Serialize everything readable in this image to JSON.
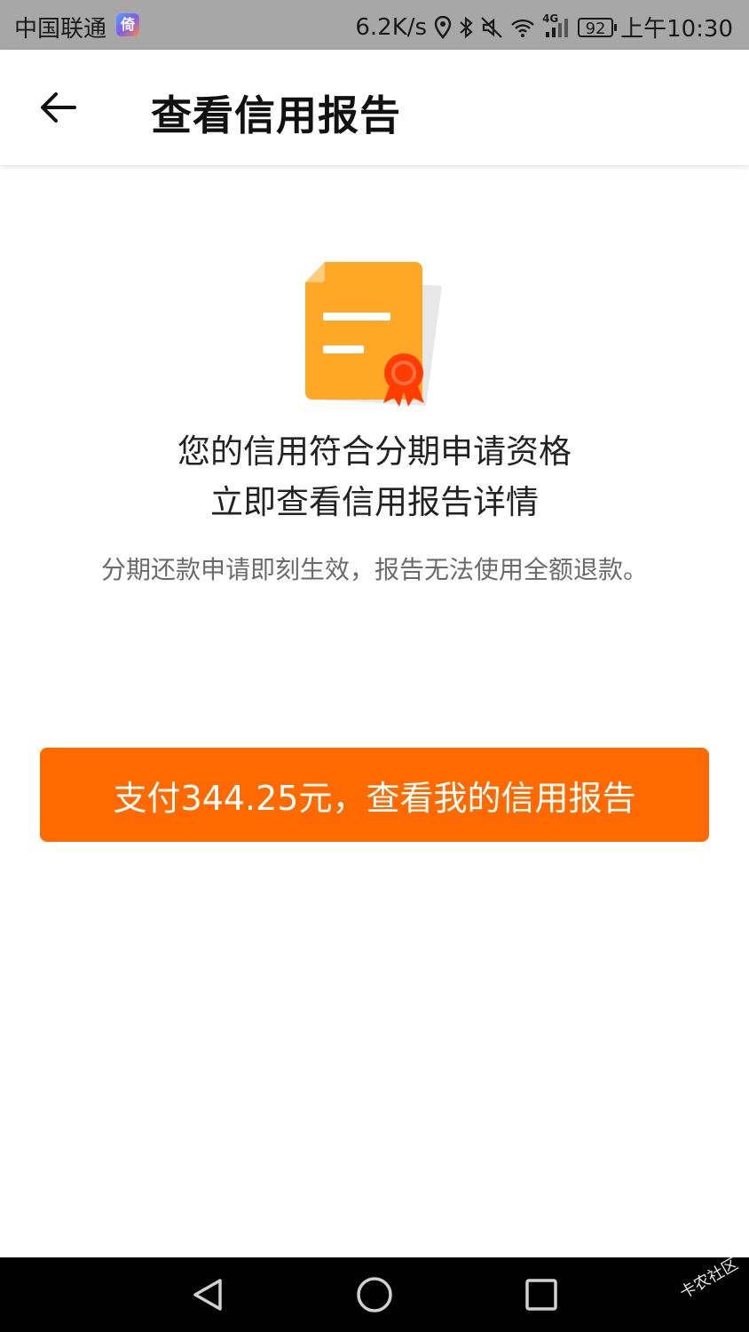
{
  "status_bar": {
    "carrier": "中国联通",
    "app_icon_char": "倚",
    "speed": "6.2K/s",
    "network": "4G",
    "battery": "92",
    "time": "上午10:30"
  },
  "header": {
    "title": "查看信用报告"
  },
  "content": {
    "headline_line1": "您的信用符合分期申请资格",
    "headline_line2": "立即查看信用报告详情",
    "subtext": "分期还款申请即刻生效，报告无法使用全额退款。"
  },
  "pay_button": {
    "label": "支付344.25元，查看我的信用报告"
  },
  "watermark": "卡农社区",
  "colors": {
    "accent": "#ff6a00",
    "doc_orange": "#ffa726",
    "ribbon_red": "#ff3d00",
    "status_bar_bg": "#a7a7a7"
  },
  "icons": {
    "back": "arrow-left-icon",
    "document": "certificate-document-icon",
    "nav_back": "triangle-back-icon",
    "nav_home": "circle-home-icon",
    "nav_recent": "square-recent-icon"
  }
}
